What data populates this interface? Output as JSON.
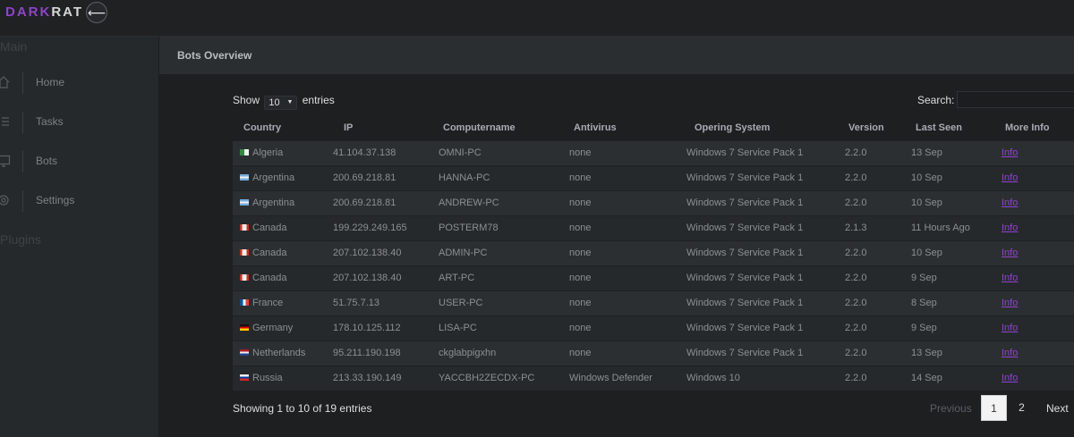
{
  "brand": {
    "dark": "DARK",
    "rat": "RAT",
    "accent": "#8e44c9"
  },
  "topbar": {
    "back_icon": "arrow-left-icon",
    "back_glyph": "⟵"
  },
  "sidebar": {
    "section_main": "Main",
    "items": [
      {
        "label": "Home",
        "icon": "home-icon"
      },
      {
        "label": "Tasks",
        "icon": "tasks-icon"
      },
      {
        "label": "Bots",
        "icon": "monitor-icon"
      },
      {
        "label": "Settings",
        "icon": "gear-icon"
      }
    ],
    "section_plugins": "Plugins"
  },
  "content": {
    "title": "Bots Overview"
  },
  "controls": {
    "show_label": "Show",
    "entries_value": "10",
    "entries_label": "entries",
    "search_label": "Search:",
    "search_value": ""
  },
  "table": {
    "headers": [
      "Country",
      "IP",
      "Computername",
      "Antivirus",
      "Opering System",
      "Version",
      "Last Seen",
      "More Info"
    ],
    "rows": [
      {
        "country": "Algeria",
        "flag": "algeria-flag-icon",
        "ip": "41.104.37.138",
        "name": "OMNI-PC",
        "av": "none",
        "os": "Windows 7 Service Pack 1",
        "version": "2.2.0",
        "seen": "13 Sep",
        "info": "Info"
      },
      {
        "country": "Argentina",
        "flag": "argentina-flag-icon",
        "ip": "200.69.218.81",
        "name": "HANNA-PC",
        "av": "none",
        "os": "Windows 7 Service Pack 1",
        "version": "2.2.0",
        "seen": "10 Sep",
        "info": "Info"
      },
      {
        "country": "Argentina",
        "flag": "argentina-flag-icon",
        "ip": "200.69.218.81",
        "name": "ANDREW-PC",
        "av": "none",
        "os": "Windows 7 Service Pack 1",
        "version": "2.2.0",
        "seen": "10 Sep",
        "info": "Info"
      },
      {
        "country": "Canada",
        "flag": "canada-flag-icon",
        "ip": "199.229.249.165",
        "name": "POSTERM78",
        "av": "none",
        "os": "Windows 7 Service Pack 1",
        "version": "2.1.3",
        "seen": "11 Hours Ago",
        "info": "Info"
      },
      {
        "country": "Canada",
        "flag": "canada-flag-icon",
        "ip": "207.102.138.40",
        "name": "ADMIN-PC",
        "av": "none",
        "os": "Windows 7 Service Pack 1",
        "version": "2.2.0",
        "seen": "10 Sep",
        "info": "Info"
      },
      {
        "country": "Canada",
        "flag": "canada-flag-icon",
        "ip": "207.102.138.40",
        "name": "ART-PC",
        "av": "none",
        "os": "Windows 7 Service Pack 1",
        "version": "2.2.0",
        "seen": "9 Sep",
        "info": "Info"
      },
      {
        "country": "France",
        "flag": "france-flag-icon",
        "ip": "51.75.7.13",
        "name": "USER-PC",
        "av": "none",
        "os": "Windows 7 Service Pack 1",
        "version": "2.2.0",
        "seen": "8 Sep",
        "info": "Info"
      },
      {
        "country": "Germany",
        "flag": "germany-flag-icon",
        "ip": "178.10.125.112",
        "name": "LISA-PC",
        "av": "none",
        "os": "Windows 7 Service Pack 1",
        "version": "2.2.0",
        "seen": "9 Sep",
        "info": "Info"
      },
      {
        "country": "Netherlands",
        "flag": "netherlands-flag-icon",
        "ip": "95.211.190.198",
        "name": "ckglabpigxhn",
        "av": "none",
        "os": "Windows 7 Service Pack 1",
        "version": "2.2.0",
        "seen": "13 Sep",
        "info": "Info"
      },
      {
        "country": "Russia",
        "flag": "russia-flag-icon",
        "ip": "213.33.190.149",
        "name": "YACCBH2ZECDX-PC",
        "av": "Windows Defender",
        "os": "Windows 10",
        "version": "2.2.0",
        "seen": "14 Sep",
        "info": "Info"
      }
    ]
  },
  "footer": {
    "showing": "Showing 1 to 10 of 19 entries",
    "previous": "Previous",
    "pages": [
      "1",
      "2"
    ],
    "active_page": "1",
    "next": "Next"
  }
}
